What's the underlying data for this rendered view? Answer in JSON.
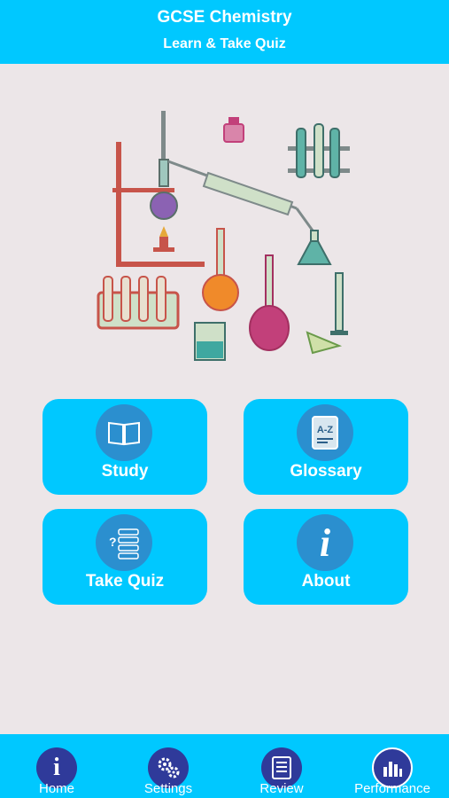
{
  "header": {
    "title": "GCSE Chemistry",
    "subtitle": "Learn & Take Quiz"
  },
  "illustration": {
    "name": "chemistry-lab-equipment-illustration"
  },
  "tiles": [
    {
      "label": "Study",
      "icon": "open-book-icon"
    },
    {
      "label": "Glossary",
      "icon": "a-z-dictionary-icon",
      "icon_text": "A-Z"
    },
    {
      "label": "Take Quiz",
      "icon": "quiz-list-icon"
    },
    {
      "label": "About",
      "icon": "info-icon",
      "icon_text": "i"
    }
  ],
  "tabbar": {
    "items": [
      {
        "label": "Home",
        "icon": "info-icon",
        "icon_text": "i"
      },
      {
        "label": "Settings",
        "icon": "gears-icon"
      },
      {
        "label": "Review",
        "icon": "checklist-icon"
      },
      {
        "label": "Performance",
        "icon": "bar-chart-icon",
        "active": true
      }
    ]
  },
  "colors": {
    "accent": "#00c8ff",
    "tile_circle": "#2b8fcf",
    "tab_circle": "#2f3a9a",
    "background": "#ece6e8"
  }
}
